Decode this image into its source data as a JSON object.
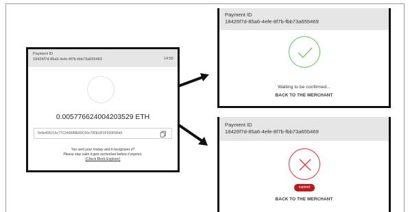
{
  "main_card": {
    "payment_id_label": "Payment ID",
    "payment_id": "18426f7d-85a6-4efe-8f7b-fbb73a655469",
    "timer": "14:55",
    "amount": "0.005776624004203529 ETH",
    "address": "0x9e405215c77C240588E89C69c79f3b3F3F930F85d9",
    "note_line1": "You sent your money and it recognizes it?",
    "note_line2": "Please stay calm it gets rechecked before it expires.",
    "explorer_link": "(Check Block Explorer)"
  },
  "success_card": {
    "payment_id_label": "Payment ID",
    "payment_id": "18426f7d-85a6-4efe-8f7b-fbb73a655469",
    "status_text": "Waiting to be confirmed...",
    "back_link": "BACK TO THE MERCHANT",
    "accent": "#6cc46a"
  },
  "expired_card": {
    "payment_id_label": "Payment ID",
    "payment_id": "18426f7d-85a6-4efe-8f7b-fbb73a655469",
    "badge": "expired",
    "back_link": "BACK TO THE MERCHANT",
    "accent": "#d33a3a"
  },
  "icons": [
    "progress-circle-icon",
    "copy-icon",
    "checkmark-icon",
    "cross-icon",
    "arrow-icon"
  ]
}
